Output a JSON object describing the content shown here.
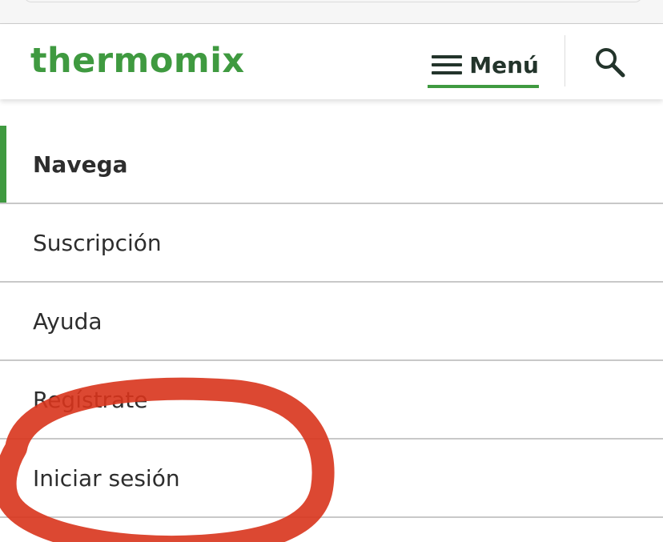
{
  "header": {
    "logo_text": "thermomix",
    "menu_label": "Menú",
    "accent_color": "#3f9a40"
  },
  "icons": {
    "menu": "hamburger-icon",
    "search": "search-icon"
  },
  "nav": {
    "items": [
      {
        "label": "Navega",
        "active": true
      },
      {
        "label": "Suscripción"
      },
      {
        "label": "Ayuda"
      },
      {
        "label": "Regístrate"
      },
      {
        "label": "Iniciar sesión"
      }
    ]
  },
  "annotation_color": "#d8341c"
}
